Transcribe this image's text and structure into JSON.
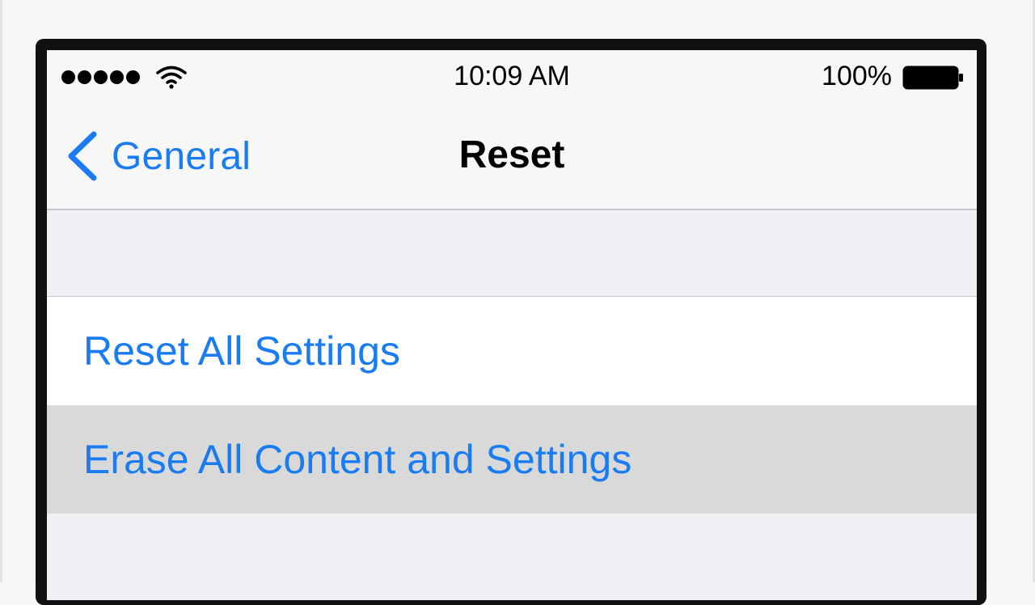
{
  "status_bar": {
    "time": "10:09 AM",
    "battery_percent": "100%",
    "signal_bars": 5,
    "wifi_icon": "wifi-icon",
    "battery_icon": "battery-full-icon"
  },
  "nav_bar": {
    "back_label": "General",
    "back_icon": "chevron-left-icon",
    "title": "Reset"
  },
  "settings": {
    "rows": [
      {
        "label": "Reset All Settings",
        "highlighted": false
      },
      {
        "label": "Erase All Content and Settings",
        "highlighted": true
      }
    ]
  },
  "colors": {
    "accent": "#1a7cf2",
    "group_background": "#efeff4",
    "row_background": "#ffffff",
    "row_highlight": "#d9d9d9"
  }
}
